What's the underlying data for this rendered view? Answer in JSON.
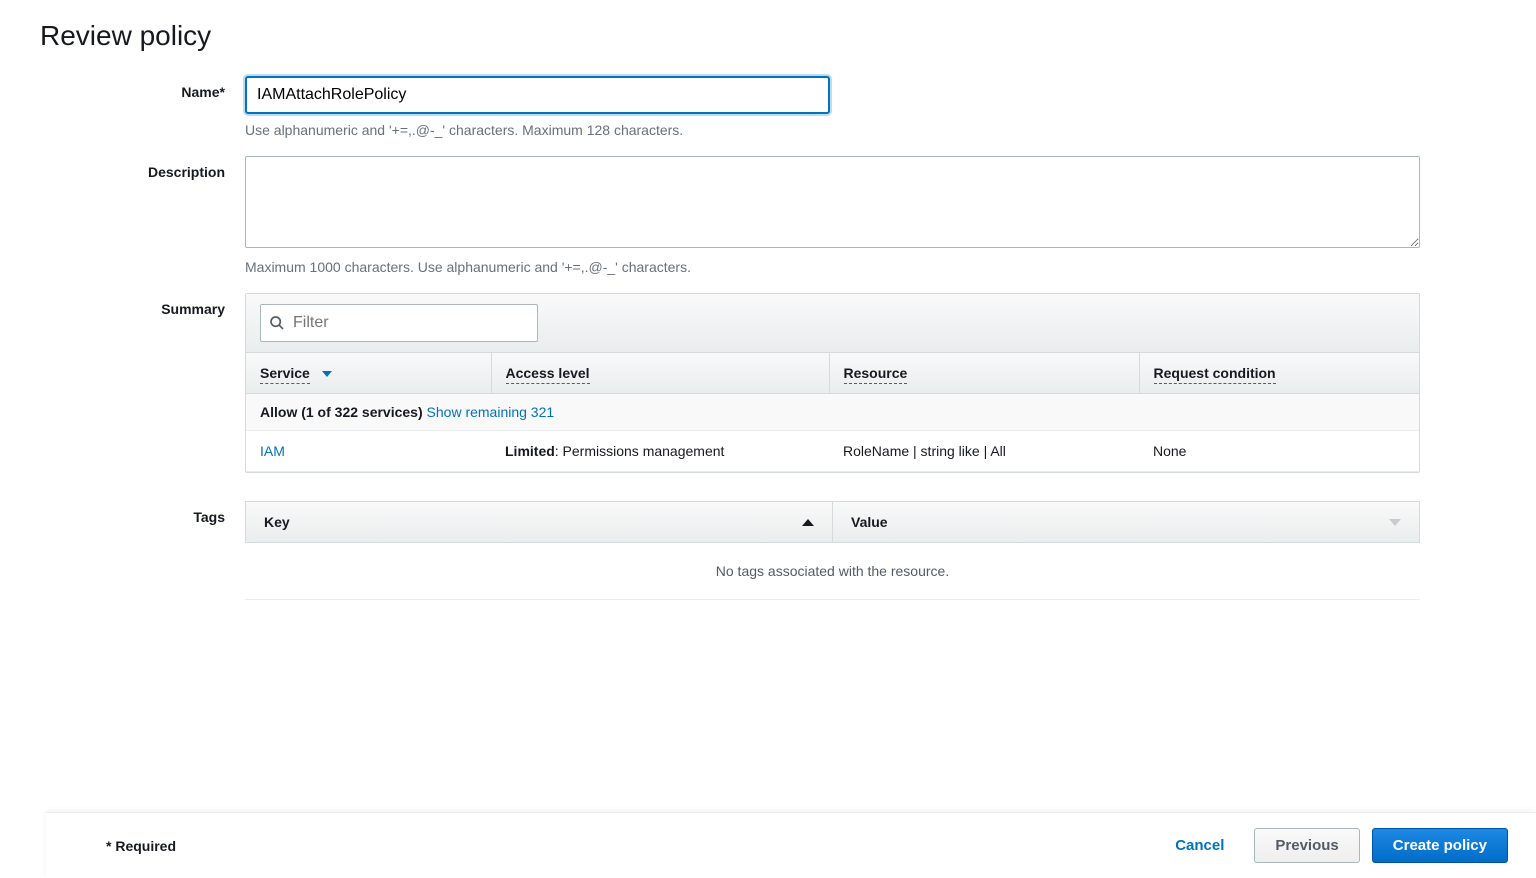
{
  "page_title": "Review policy",
  "name": {
    "label": "Name*",
    "value": "IAMAttachRolePolicy",
    "hint": "Use alphanumeric and '+=,.@-_' characters. Maximum 128 characters."
  },
  "description": {
    "label": "Description",
    "value": "",
    "hint": "Maximum 1000 characters. Use alphanumeric and '+=,.@-_' characters."
  },
  "summary": {
    "label": "Summary",
    "filter_placeholder": "Filter",
    "headers": {
      "service": "Service",
      "access_level": "Access level",
      "resource": "Resource",
      "request_condition": "Request condition"
    },
    "allow_row": {
      "text": "Allow (1 of 322 services)",
      "link": "Show remaining 321"
    },
    "rows": [
      {
        "service": "IAM",
        "access_limited": "Limited",
        "access_detail": ": Permissions management",
        "resource": "RoleName | string like | All",
        "request_condition": "None"
      }
    ]
  },
  "tags": {
    "label": "Tags",
    "key_header": "Key",
    "value_header": "Value",
    "empty_text": "No tags associated with the resource."
  },
  "footer": {
    "required": "* Required",
    "cancel": "Cancel",
    "previous": "Previous",
    "create": "Create policy"
  }
}
